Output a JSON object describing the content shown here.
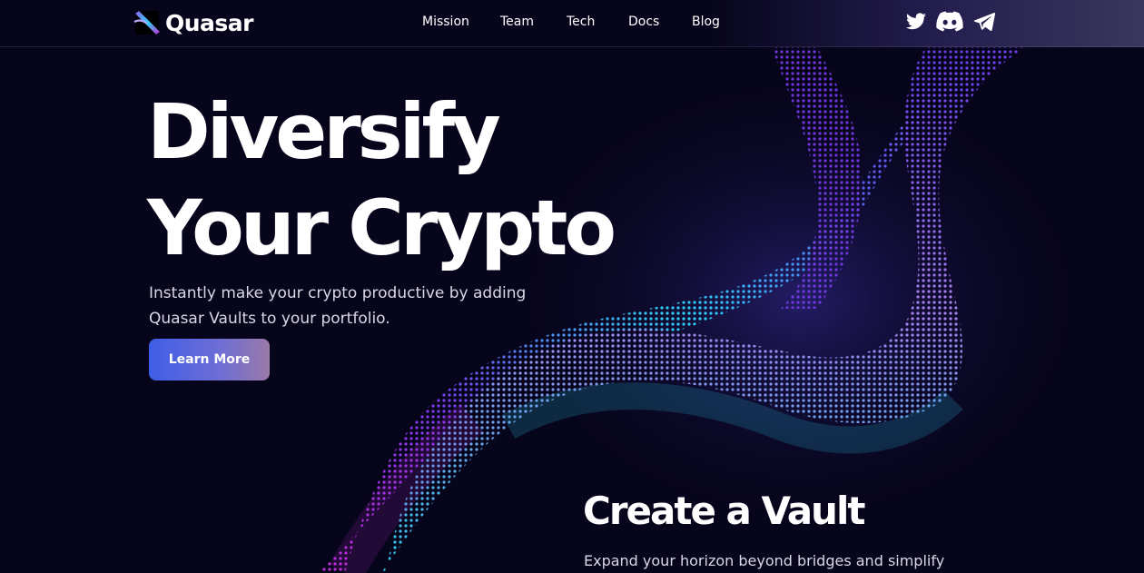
{
  "brand": {
    "name": "Quasar",
    "logo_icon": "quasar-logo-icon"
  },
  "nav": {
    "links": [
      "Mission",
      "Team",
      "Tech",
      "Docs",
      "Blog"
    ]
  },
  "social": [
    {
      "name": "twitter-icon"
    },
    {
      "name": "discord-icon"
    },
    {
      "name": "telegram-icon"
    }
  ],
  "hero": {
    "title_line1": "Diversify",
    "title_line2": "Your Crypto",
    "subtitle_line1": "Instantly make your crypto productive by adding",
    "subtitle_line2": "Quasar Vaults to your portfolio.",
    "cta_label": "Learn More"
  },
  "section": {
    "title": "Create a Vault",
    "subtitle": "Expand your horizon beyond bridges and simplify"
  },
  "colors": {
    "background": "#07051c",
    "accent_blue": "#3e5ee8",
    "accent_purple": "#8a5cf0",
    "accent_cyan": "#2fd3f5"
  }
}
